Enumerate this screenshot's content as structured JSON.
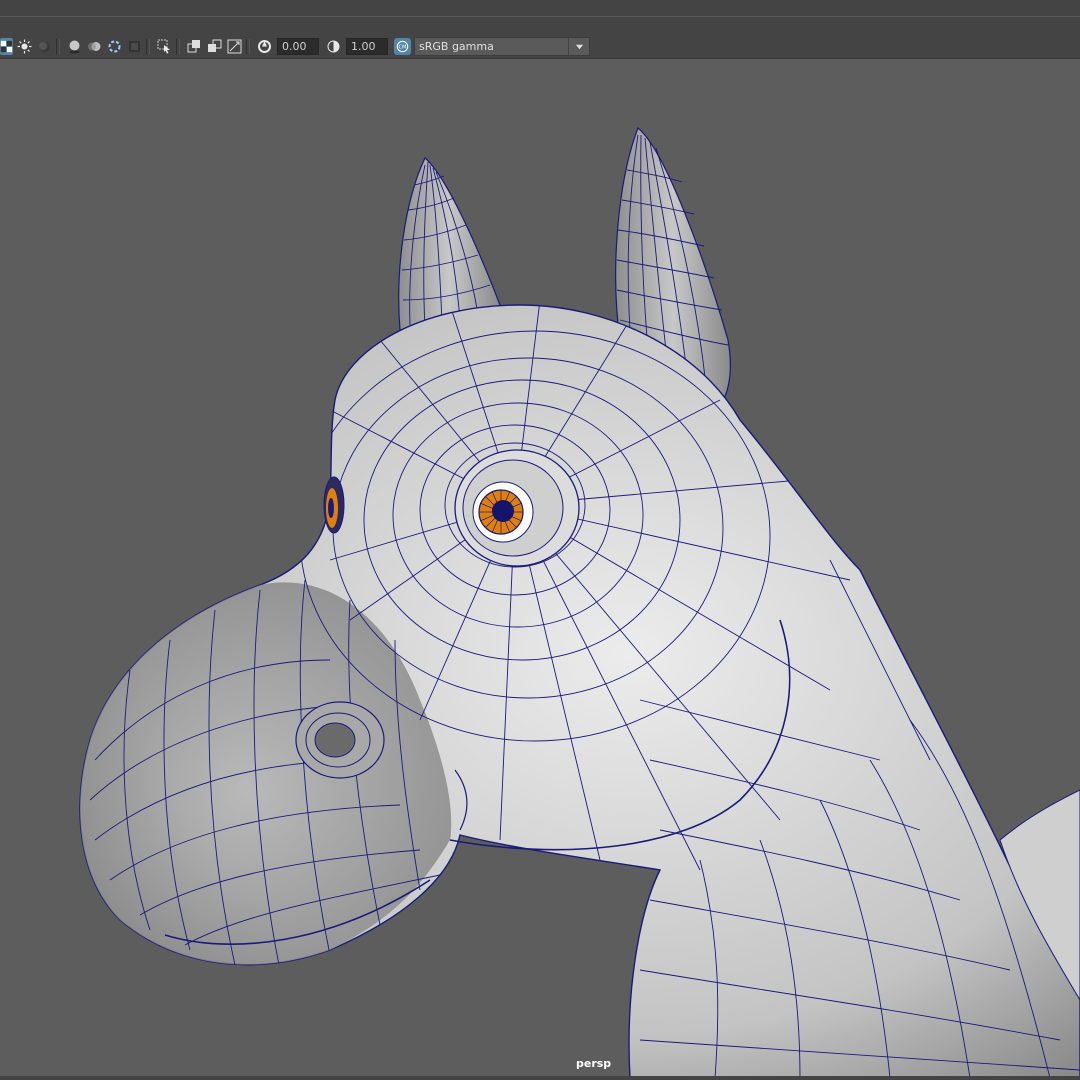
{
  "toolbar": {
    "exposure_value": "0.00",
    "gamma_value": "1.00",
    "color_space_label": "sRGB gamma",
    "icons": [
      "checker-icon",
      "light-icon",
      "shadow-icon",
      "ambient-occlusion-icon",
      "motion-blur-icon",
      "anti-alias-icon",
      "depth-icon",
      "select-highlight-icon",
      "isolate-icon",
      "xray-icon",
      "xray-joints-icon",
      "exposure-icon",
      "gamma-icon",
      "color-management-icon",
      "chevron-down-icon"
    ]
  },
  "viewport": {
    "camera_name": "persp",
    "mesh_color": "#d8d8d8",
    "wire_color": "#1a1a7a",
    "iris_color": "#e0800a"
  },
  "colors": {
    "background": "#5d5d5d",
    "panel": "#444444",
    "accent": "#5285a6"
  }
}
